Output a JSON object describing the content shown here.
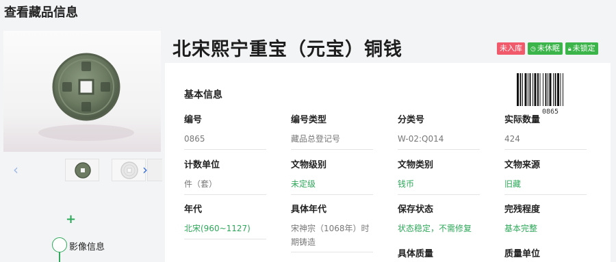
{
  "page": {
    "title": "查看藏品信息"
  },
  "object": {
    "title": "北宋熙宁重宝（元宝）铜钱",
    "badges": [
      {
        "text": "未入库",
        "color": "#f05a6a",
        "icon": ""
      },
      {
        "text": "未休眠",
        "color": "#3bb54a",
        "icon": "clock-icon"
      },
      {
        "text": "未锁定",
        "color": "#3bb54a",
        "icon": "lock-icon"
      }
    ]
  },
  "media": {
    "prev_icon": "chevron-left-icon",
    "next_icon": "chevron-right-icon",
    "add_icon": "plus-icon",
    "timeline_label": "影像信息"
  },
  "info": {
    "section_title": "基本信息",
    "barcode_number": "0865",
    "fields": [
      {
        "label": "编号",
        "value": "0865",
        "green": false
      },
      {
        "label": "编号类型",
        "value": "藏品总登记号",
        "green": false
      },
      {
        "label": "分类号",
        "value": "W-02:Q014",
        "green": false
      },
      {
        "label": "实际数量",
        "value": "424",
        "green": false
      },
      {
        "label": "计数单位",
        "value": "件（套）",
        "green": false
      },
      {
        "label": "文物级别",
        "value": "未定级",
        "green": true
      },
      {
        "label": "文物类别",
        "value": "钱币",
        "green": true
      },
      {
        "label": "文物来源",
        "value": "旧藏",
        "green": true
      },
      {
        "label": "年代",
        "value": "北宋(960~1127)",
        "green": true
      },
      {
        "label": "具体年代",
        "value": "宋神宗（1068年）时期铸造",
        "green": false
      },
      {
        "label": "保存状态",
        "value": "状态稳定，不需修复",
        "green": true
      },
      {
        "label": "完残程度",
        "value": "基本完整",
        "green": true
      },
      {
        "label": "具体质量",
        "value": "",
        "green": false
      },
      {
        "label": "质量单位",
        "value": "",
        "green": false
      }
    ]
  }
}
